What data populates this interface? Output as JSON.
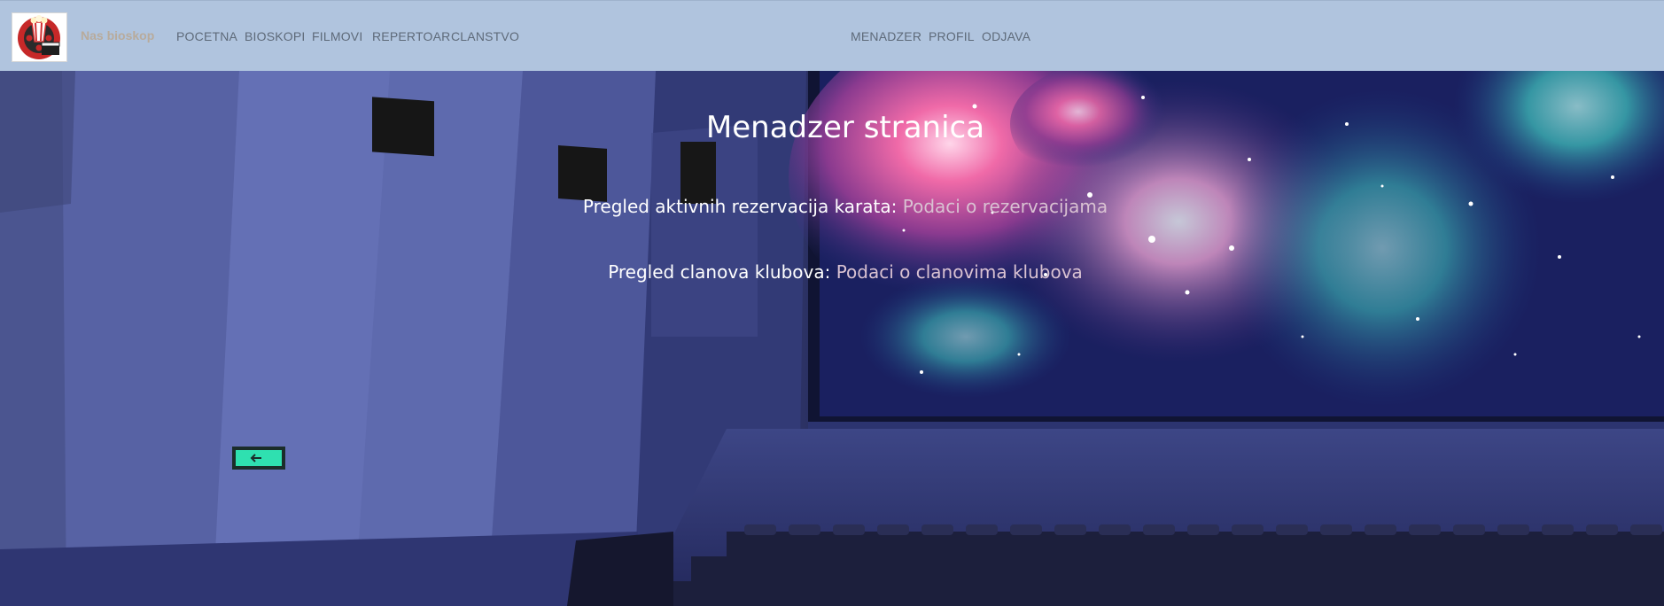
{
  "nav": {
    "brand": "Nas bioskop",
    "left_links": [
      {
        "label": "POCETNA"
      },
      {
        "label": "BIOSKOPI"
      },
      {
        "label": "FILMOVI"
      },
      {
        "label": "REPERTOAR"
      },
      {
        "label": "CLANSTVO"
      }
    ],
    "right_links": [
      {
        "label": "MENADZER"
      },
      {
        "label": "PROFIL"
      },
      {
        "label": "ODJAVA"
      }
    ]
  },
  "main": {
    "title": "Menadzer stranica",
    "reservations": {
      "label": "Pregled aktivnih rezervacija karata:",
      "link": "Podaci o rezervacijama"
    },
    "members": {
      "label": "Pregled clanova klubova:",
      "link": "Podaci o clanovima klubova"
    }
  },
  "colors": {
    "navbar_bg": "#b0c4de",
    "nav_text": "#5e6a79",
    "brand_text": "#b8ab9c",
    "link_text": "#d9c2d2"
  }
}
